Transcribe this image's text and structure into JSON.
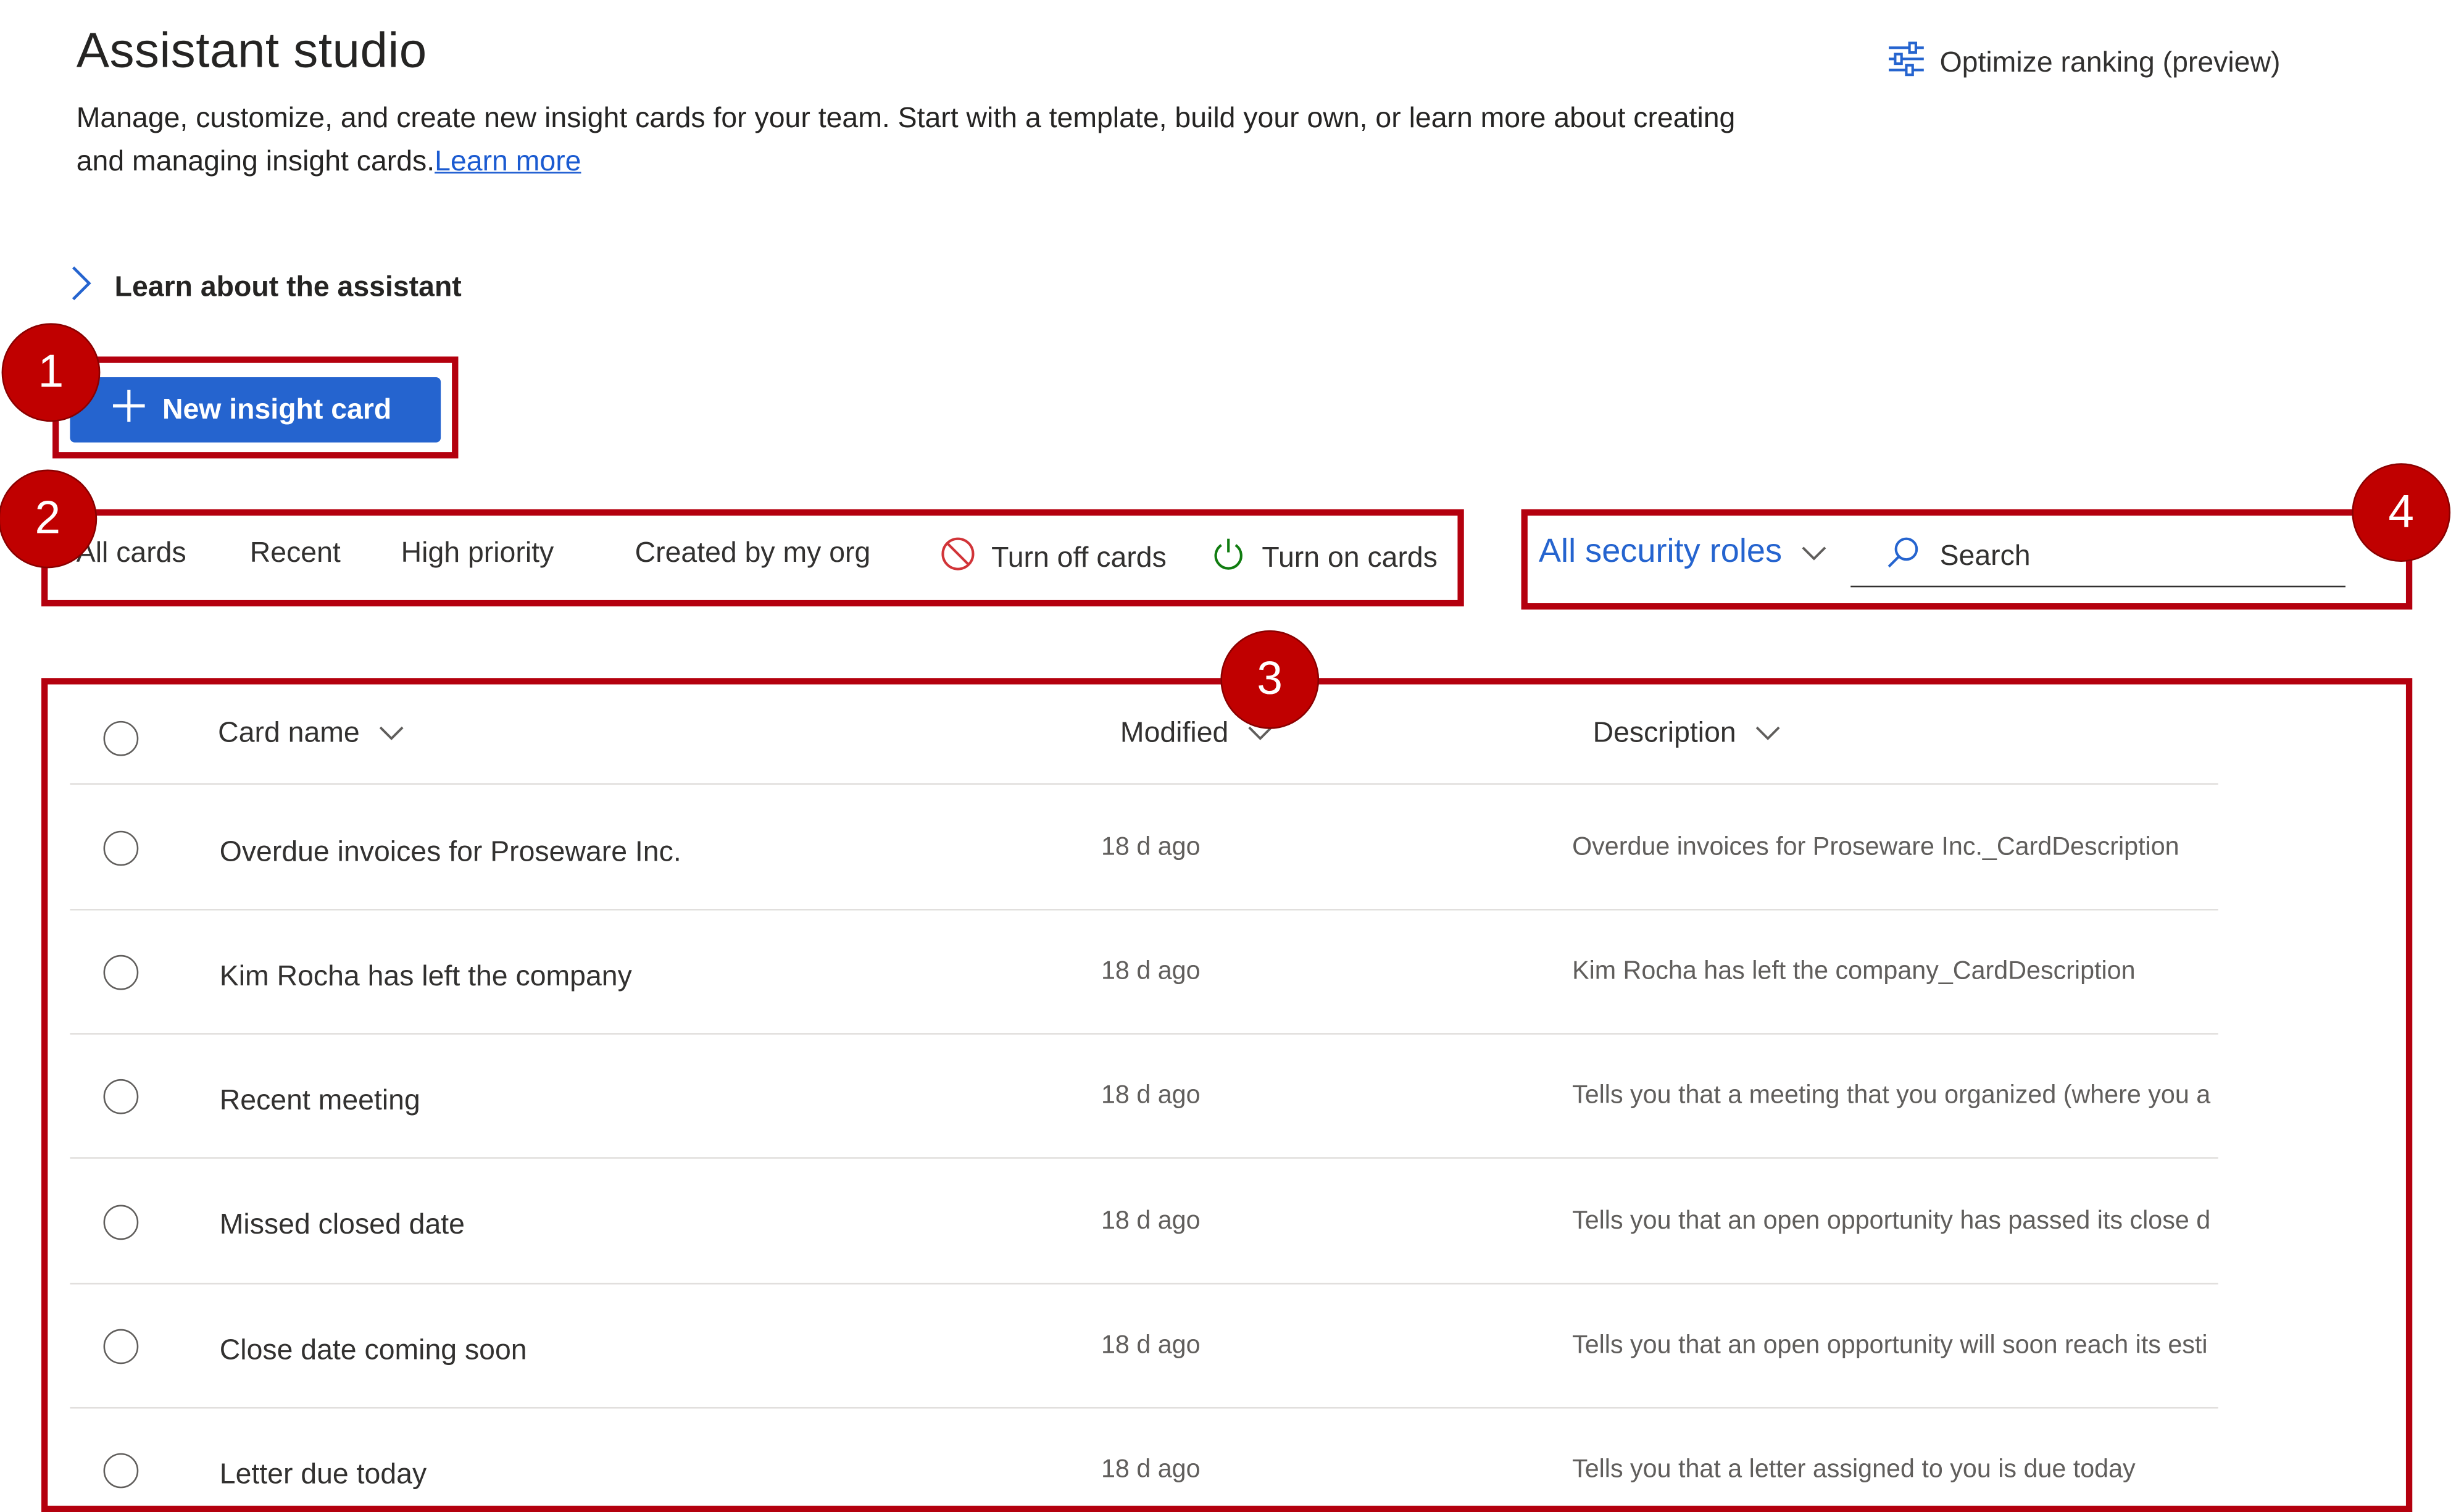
{
  "header": {
    "title": "Assistant studio",
    "description": "Manage, customize, and create new insight cards for your team. Start with a template, build your own, or learn more about creating and managing insight cards.",
    "learn_more_link": "Learn more",
    "optimize_label": "Optimize ranking (preview)"
  },
  "learn_section": {
    "label": "Learn about the assistant"
  },
  "new_card_button": {
    "label": "New insight card"
  },
  "command_bar": {
    "all_cards": "All cards",
    "recent": "Recent",
    "high_priority": "High priority",
    "created_by_my_org": "Created by my org",
    "turn_off_cards": "Turn off cards",
    "turn_on_cards": "Turn on cards"
  },
  "filter": {
    "security_roles": "All security roles"
  },
  "search": {
    "placeholder": "Search"
  },
  "grid": {
    "columns": {
      "card_name": "Card name",
      "modified": "Modified",
      "description": "Description"
    },
    "rows": [
      {
        "name": "Overdue invoices for Proseware Inc.",
        "modified": "18 d ago",
        "description": "Overdue invoices for Proseware Inc._CardDescription"
      },
      {
        "name": "Kim Rocha has left the company",
        "modified": "18 d ago",
        "description": "Kim Rocha has left the company_CardDescription"
      },
      {
        "name": "Recent meeting",
        "modified": "18 d ago",
        "description": "Tells you that a meeting that you organized (where you a"
      },
      {
        "name": "Missed closed date",
        "modified": "18 d ago",
        "description": "Tells you that an open opportunity has passed its close d"
      },
      {
        "name": "Close date coming soon",
        "modified": "18 d ago",
        "description": "Tells you that an open opportunity will soon reach its esti"
      },
      {
        "name": "Letter due today",
        "modified": "18 d ago",
        "description": "Tells you that a letter assigned to you is due today"
      }
    ]
  },
  "annotations": {
    "badge_1": "1",
    "badge_2": "2",
    "badge_3": "3",
    "badge_4": "4"
  },
  "colors": {
    "accent": "#2564cf",
    "annotation_red": "#c00000",
    "link": "#1b5bd1"
  }
}
